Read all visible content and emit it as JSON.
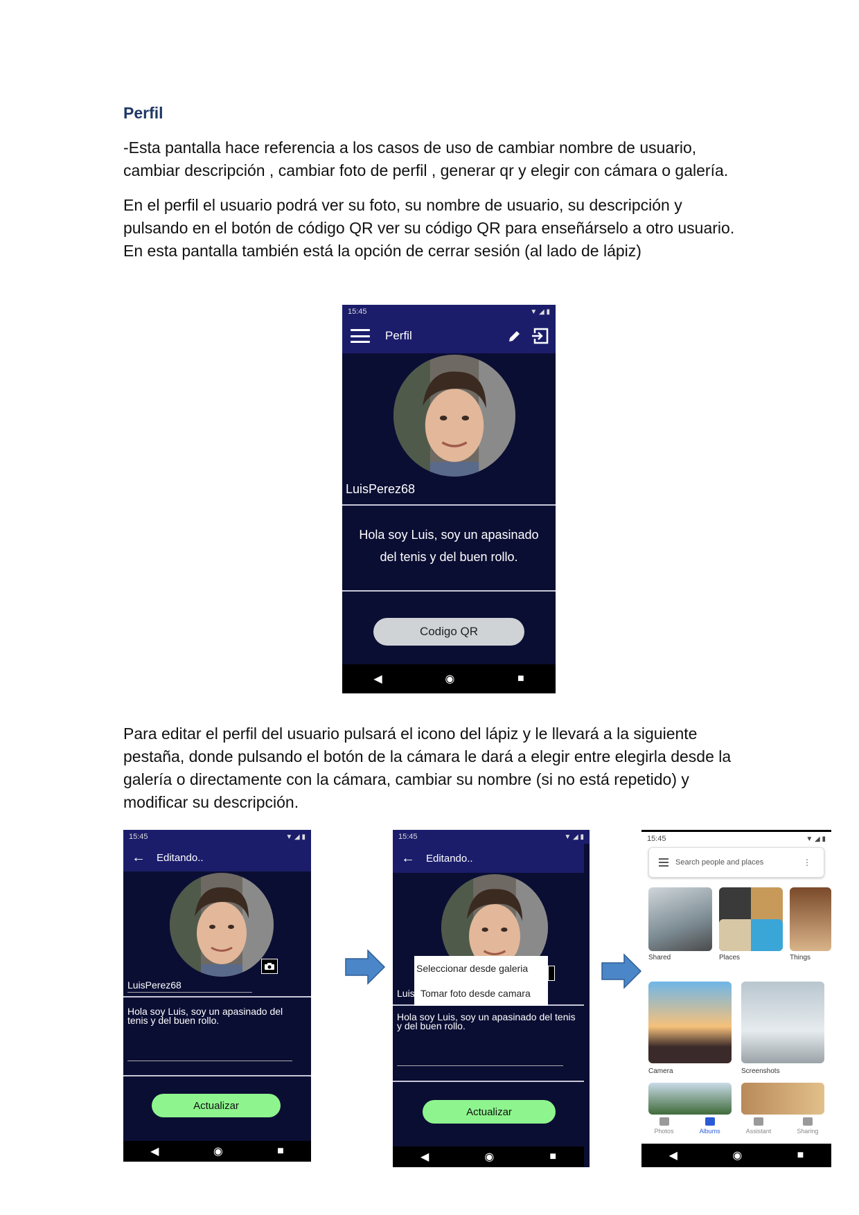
{
  "heading": "Perfil",
  "intro": "-Esta pantalla hace referencia a los casos de uso de  cambiar nombre de usuario, cambiar descripción , cambiar foto de perfil , generar qr y elegir con cámara o galería.",
  "para2": "En el perfil el usuario podrá ver su foto, su nombre de usuario, su descripción y pulsando en el botón de código QR ver su código QR para enseñárselo a otro usuario. En esta pantalla también está la opción de cerrar sesión (al lado de lápiz)",
  "para3": "Para editar el perfil del usuario pulsará el icono del lápiz y le llevará a la siguiente pestaña, donde pulsando el botón de la cámara le dará a elegir entre elegirla desde la galería o directamente con la cámara, cambiar su nombre (si no está repetido) y modificar su descripción.",
  "profile": {
    "time": "15:45",
    "title": "Perfil",
    "username": "LuisPerez68",
    "description": "Hola soy Luis, soy un apasinado del tenis y del buen rollo.",
    "qr_button": "Codigo QR"
  },
  "edit": {
    "time": "15:45",
    "title": "Editando..",
    "username": "LuisPerez68",
    "username_partial": "Luis",
    "description": "Hola soy Luis, soy un apasinado del tenis y del buen rollo.",
    "update_button": "Actualizar",
    "popup_options": [
      "Seleccionar desde galeria",
      "Tomar foto desde camara"
    ]
  },
  "gallery": {
    "time": "15:45",
    "search_placeholder": "Search people and places",
    "categories": [
      "Shared",
      "Places",
      "Things",
      "Camera",
      "Screenshots"
    ],
    "tabs": [
      "Photos",
      "Albums",
      "Assistant",
      "Sharing"
    ],
    "active_tab": "Albums"
  },
  "colors": {
    "app_background": "#0b0e33",
    "app_bar": "#1b1d6b",
    "update_button": "#8ef58e",
    "qr_button": "#cfd3d6",
    "heading": "#1f3864",
    "arrow": "#4a86c8"
  }
}
